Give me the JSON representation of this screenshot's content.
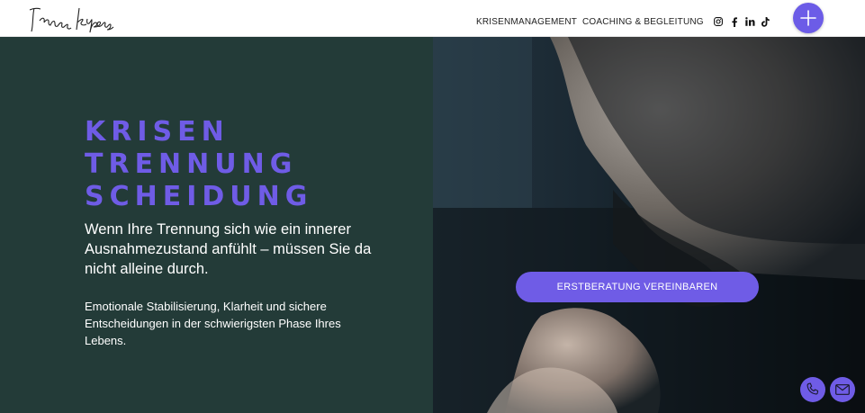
{
  "header": {
    "logo_text": "Irina Kipens",
    "nav": [
      {
        "label": "KRISENMANAGEMENT"
      },
      {
        "label": "COACHING & BEGLEITUNG"
      }
    ],
    "social_icons": [
      "instagram-icon",
      "facebook-icon",
      "linkedin-icon",
      "tiktok-icon"
    ],
    "menu_button_icon": "plus-icon"
  },
  "hero": {
    "headline": [
      "KRISEN",
      "TRENNUNG",
      "SCHEIDUNG"
    ],
    "lead": "Wenn Ihre Trennung sich wie ein innerer Ausnahmezustand anfühlt – müssen Sie da nicht alleine durch.",
    "sub": "Emotionale Stabilisierung, Klarheit und sichere Entscheidungen in der schwierigsten Phase Ihres Lebens.",
    "cta": "ERSTBERATUNG VEREINBAREN"
  },
  "floating": {
    "phone_icon": "phone-icon",
    "mail_icon": "mail-icon"
  },
  "colors": {
    "accent": "#6f5ce6",
    "panel": "#233b38",
    "header_bg": "#ffffff"
  }
}
